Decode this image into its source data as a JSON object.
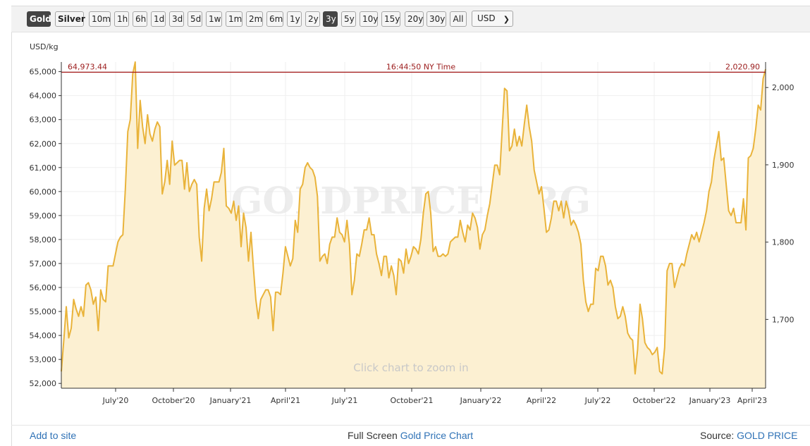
{
  "toolbar": {
    "metals": [
      {
        "label": "Gold",
        "active": true
      },
      {
        "label": "Silver",
        "active": false
      }
    ],
    "ranges": [
      {
        "label": "10m",
        "active": false
      },
      {
        "label": "1h",
        "active": false
      },
      {
        "label": "6h",
        "active": false
      },
      {
        "label": "1d",
        "active": false
      },
      {
        "label": "3d",
        "active": false
      },
      {
        "label": "5d",
        "active": false
      },
      {
        "label": "1w",
        "active": false
      },
      {
        "label": "1m",
        "active": false
      },
      {
        "label": "2m",
        "active": false
      },
      {
        "label": "6m",
        "active": false
      },
      {
        "label": "1y",
        "active": false
      },
      {
        "label": "2y",
        "active": false
      },
      {
        "label": "3y",
        "active": true
      },
      {
        "label": "5y",
        "active": false
      },
      {
        "label": "10y",
        "active": false
      },
      {
        "label": "15y",
        "active": false
      },
      {
        "label": "20y",
        "active": false
      },
      {
        "label": "30y",
        "active": false
      },
      {
        "label": "All",
        "active": false
      }
    ],
    "currency": "USD"
  },
  "chart_data": {
    "type": "area",
    "ylabel_left": "USD/kg",
    "left_ticks": [
      "52,000",
      "53,000",
      "54,000",
      "55,000",
      "56,000",
      "57,000",
      "58,000",
      "59,000",
      "60,000",
      "61,000",
      "62,000",
      "63,000",
      "64,000",
      "65,000"
    ],
    "right_ticks": [
      "1,700",
      "1,800",
      "1,900",
      "2,000"
    ],
    "x_ticks": [
      "July'20",
      "October'20",
      "January'21",
      "April'21",
      "July'21",
      "October'21",
      "January'22",
      "April'22",
      "July'22",
      "October'22",
      "January'23",
      "April'23"
    ],
    "ylim_left": [
      51800,
      65400
    ],
    "ylim_right": [
      1611,
      2033
    ],
    "reference_line": {
      "left_label": "64,973.44",
      "center_label": "16:44:50 NY Time",
      "right_label": "2,020.90",
      "value": 64973.44
    },
    "watermark": "GOLDPRICE.ORG",
    "zoom_hint": "Click chart to zoom in",
    "series": [
      {
        "color": "#e9b33a",
        "values_usd_per_kg": [
          52500,
          53800,
          55200,
          53900,
          54300,
          55500,
          55100,
          54800,
          55200,
          54800,
          56100,
          56200,
          55900,
          55300,
          55600,
          54200,
          55900,
          55500,
          55400,
          56900,
          56900,
          56900,
          57400,
          57900,
          58100,
          58200,
          60100,
          62500,
          63000,
          64900,
          65400,
          61800,
          63800,
          62700,
          62000,
          63200,
          62400,
          62100,
          62600,
          62900,
          62700,
          59900,
          60400,
          61300,
          60300,
          62100,
          61100,
          61200,
          61300,
          61300,
          60100,
          61200,
          60000,
          60300,
          60500,
          60300,
          58100,
          57100,
          59300,
          60100,
          59200,
          59700,
          60400,
          60400,
          60400,
          60800,
          61800,
          59400,
          59300,
          59100,
          59600,
          58800,
          59400,
          57700,
          59100,
          58500,
          57100,
          58300,
          56800,
          55500,
          54700,
          55500,
          55700,
          55900,
          55900,
          55600,
          54200,
          55800,
          55800,
          55700,
          56600,
          57700,
          57300,
          56900,
          57200,
          58800,
          58300,
          60100,
          60300,
          61000,
          61200,
          61000,
          60900,
          60600,
          59800,
          57100,
          57300,
          57400,
          57000,
          57800,
          58100,
          58100,
          58900,
          58300,
          58200,
          57900,
          58800,
          57800,
          55700,
          56300,
          57400,
          57300,
          57800,
          58400,
          58400,
          58900,
          58200,
          58200,
          57400,
          57000,
          56500,
          57300,
          57300,
          56400,
          56900,
          56500,
          55700,
          57200,
          57100,
          56600,
          57600,
          57000,
          57300,
          57700,
          57600,
          57400,
          58000,
          59100,
          59900,
          60000,
          59100,
          57500,
          57700,
          57300,
          57300,
          57400,
          57300,
          57400,
          57900,
          58000,
          58100,
          58100,
          58800,
          58300,
          57900,
          58600,
          58400,
          59100,
          58900,
          58500,
          57600,
          58200,
          58400,
          59000,
          59500,
          60300,
          61100,
          61100,
          60700,
          62500,
          64300,
          64200,
          61700,
          61900,
          62600,
          61900,
          62300,
          61900,
          62800,
          63600,
          62700,
          62100,
          60900,
          60400,
          59900,
          60200,
          59300,
          58300,
          58400,
          58900,
          59600,
          59600,
          59200,
          59600,
          58900,
          59600,
          59200,
          58600,
          58800,
          58600,
          58300,
          57800,
          56300,
          55400,
          55000,
          55300,
          55300,
          56800,
          56700,
          57300,
          57300,
          56900,
          56100,
          56300,
          56000,
          55200,
          54700,
          54800,
          55200,
          54800,
          54100,
          53900,
          53800,
          52400,
          53400,
          55300,
          54700,
          53700,
          53500,
          53400,
          53200,
          53300,
          53500,
          52500,
          52400,
          53500,
          56700,
          57000,
          57000,
          56000,
          56400,
          56800,
          57000,
          56900,
          57400,
          57800,
          58200,
          58000,
          58300,
          57900,
          58300,
          58700,
          59200,
          60000,
          60400,
          61300,
          61900,
          62500,
          61300,
          61400,
          60300,
          59200,
          59000,
          59300,
          58700,
          58700,
          58700,
          59700,
          58400,
          61400,
          61500,
          61800,
          62600,
          63600,
          63400,
          64700,
          65100
        ]
      }
    ]
  },
  "footer": {
    "add_to_site": "Add to site",
    "full_screen_prefix": "Full Screen ",
    "full_screen_link": "Gold Price Chart",
    "source_prefix": "Source: ",
    "source_link": "GOLD PRICE"
  }
}
